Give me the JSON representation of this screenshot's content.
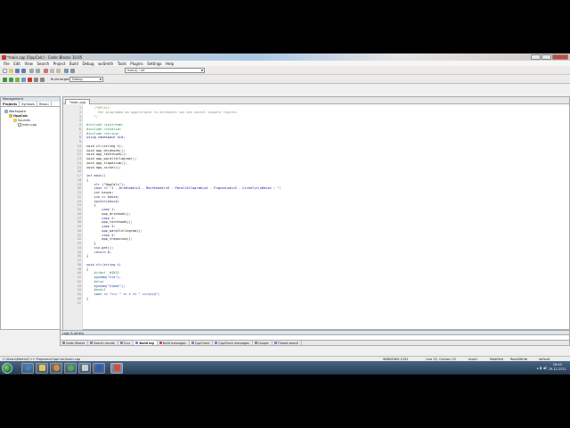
{
  "window": {
    "title": "*main.cpp [OppCalc] - Code::Blocks 10.05"
  },
  "menu": [
    "File",
    "Edit",
    "View",
    "Search",
    "Project",
    "Build",
    "Debug",
    "wxSmith",
    "Tools",
    "Plugins",
    "Settings",
    "Help"
  ],
  "toolbar": {
    "build_target_label": "Build target:",
    "build_target_value": "Debug",
    "scope_combo": "main() : int"
  },
  "management": {
    "header": "Management",
    "tabs": [
      "Projects",
      "Symbols",
      "Resou"
    ],
    "tree": {
      "workspace": "Workspace",
      "project": "OppCalc",
      "folder": "Sources",
      "file": "main.cpp"
    }
  },
  "editor": {
    "tab_label": "*main.cpp",
    "lines": [
      {
        "n": "1",
        "t": "    /*OPCALC",
        "c": "comment"
      },
      {
        "n": "2",
        "t": "      Een programma om oppervlakte te berekenen van een aantal simpele figuren",
        "c": "comment"
      },
      {
        "n": "3",
        "t": "    */",
        "c": "comment"
      },
      {
        "n": "4",
        "t": "",
        "c": "plain"
      },
      {
        "n": "5",
        "t": "#include <iostream>",
        "c": "pre"
      },
      {
        "n": "6",
        "t": "#include <cstdlib>",
        "c": "pre"
      },
      {
        "n": "7",
        "t": "#include <string>",
        "c": "pre"
      },
      {
        "n": "8",
        "t": "using namespace std;",
        "c": "kw"
      },
      {
        "n": "9",
        "t": "",
        "c": "plain"
      },
      {
        "n": "10",
        "t": "void clr(string t);",
        "c": "plain"
      },
      {
        "n": "11",
        "t": "void opp_driehoek();",
        "c": "plain"
      },
      {
        "n": "12",
        "t": "void opp_rechthoek();",
        "c": "plain"
      },
      {
        "n": "13",
        "t": "void opp_parallellogram();",
        "c": "plain"
      },
      {
        "n": "14",
        "t": "void opp_trapezium();",
        "c": "plain"
      },
      {
        "n": "15",
        "t": "void opp_cirkel();",
        "c": "plain"
      },
      {
        "n": "16",
        "t": "",
        "c": "plain"
      },
      {
        "n": "17",
        "t": "int main()",
        "c": "kw"
      },
      {
        "n": "18",
        "t": "{",
        "c": "plain"
      },
      {
        "n": "19",
        "t": "    clr (\"OppCalc\");",
        "c": "plain"
      },
      {
        "n": "20",
        "t": "    cout << \"1 - Driehoek\\n2 - Rechthoek\\n3 - Parallellogram\\n4 - Trapezium\\n5 - Cirkel\\n\\nKeuze : \";",
        "c": "str"
      },
      {
        "n": "21",
        "t": "    int keuze;",
        "c": "plain"
      },
      {
        "n": "22",
        "t": "    cin >> keuze;",
        "c": "plain"
      },
      {
        "n": "23",
        "t": "    switch(keuze)",
        "c": "kw"
      },
      {
        "n": "24",
        "t": "    {",
        "c": "plain"
      },
      {
        "n": "25",
        "t": "        case 1:",
        "c": "kw"
      },
      {
        "n": "26",
        "t": "        opp_driehoek();",
        "c": "plain"
      },
      {
        "n": "27",
        "t": "        case 2:",
        "c": "kw"
      },
      {
        "n": "28",
        "t": "        opp_rechthoek();",
        "c": "plain"
      },
      {
        "n": "29",
        "t": "        case 3:",
        "c": "kw"
      },
      {
        "n": "30",
        "t": "        opp_parallellogram();",
        "c": "plain"
      },
      {
        "n": "31",
        "t": "        case 4:",
        "c": "kw"
      },
      {
        "n": "32",
        "t": "        opp_trapezium();",
        "c": "plain"
      },
      {
        "n": "33",
        "t": "    }",
        "c": "plain"
      },
      {
        "n": "34",
        "t": "    cin.get();",
        "c": "plain"
      },
      {
        "n": "35",
        "t": "    return 0;",
        "c": "kw"
      },
      {
        "n": "36",
        "t": "}",
        "c": "plain"
      },
      {
        "n": "37",
        "t": "",
        "c": "plain"
      },
      {
        "n": "38",
        "t": "void clr(string t)",
        "c": "kw"
      },
      {
        "n": "39",
        "t": "{",
        "c": "plain"
      },
      {
        "n": "40",
        "t": "    #ifdef _WIN32",
        "c": "pre"
      },
      {
        "n": "41",
        "t": "    system(\"cls\");",
        "c": "str"
      },
      {
        "n": "42",
        "t": "    #else",
        "c": "pre"
      },
      {
        "n": "43",
        "t": "    system(\"clear\");",
        "c": "str"
      },
      {
        "n": "44",
        "t": "    #endif",
        "c": "pre"
      },
      {
        "n": "45",
        "t": "    cout << \"=== \" << t << \" ===\\n\\n\";",
        "c": "str"
      },
      {
        "n": "46",
        "t": "}",
        "c": "plain"
      },
      {
        "n": "47",
        "t": "",
        "c": "plain"
      }
    ]
  },
  "logs": {
    "title": "Logs & others",
    "tabs": [
      "Code::Blocks",
      "Search results",
      "Cccc",
      "Build log",
      "Build messages",
      "CppCheck",
      "CppCheck messages",
      "Cscope",
      "Thread search"
    ],
    "active_tab": "Build log"
  },
  "status": {
    "path": "C:\\Users\\Martin\\C++ Projecten\\OppCalc\\main.cpp",
    "encoding": "WINDOWS-1252",
    "position": "Line 32, Column 22",
    "mode": "Insert",
    "modified": "Modified",
    "rw": "Read/Write",
    "profile": "default"
  },
  "taskbar": {
    "time": "18:45",
    "date": "29-12-2011"
  },
  "colors": {
    "comment": "#7a9d6a",
    "preprocessor": "#2e8b57",
    "keyword": "#1a1a8c",
    "string": "#0a0aa8"
  }
}
